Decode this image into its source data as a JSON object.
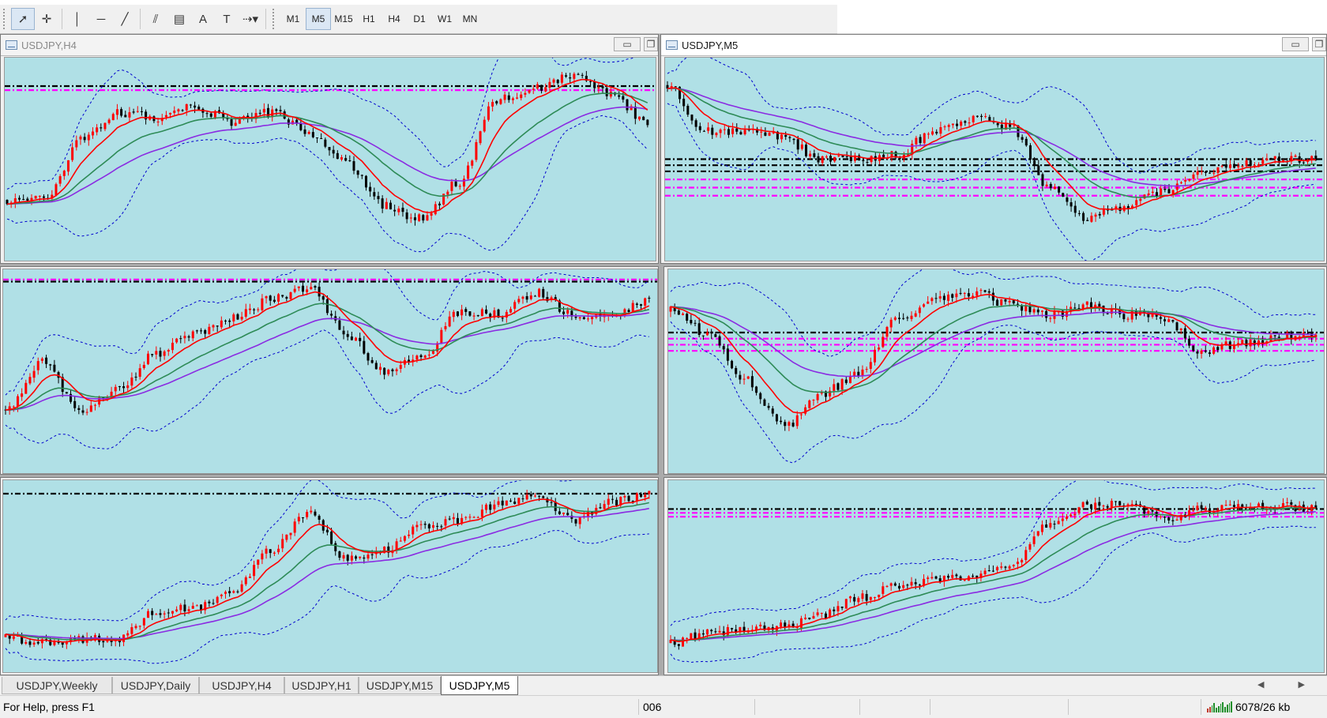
{
  "toolbar": {
    "tools": [
      {
        "icon": "cursor-arrow-icon",
        "glyph": "➚"
      },
      {
        "icon": "crosshair-icon",
        "glyph": "✛"
      },
      {
        "icon": "vertical-line-icon",
        "glyph": "│"
      },
      {
        "icon": "horizontal-line-icon",
        "glyph": "─"
      },
      {
        "icon": "trendline-icon",
        "glyph": "╱"
      },
      {
        "icon": "equidistant-channel-icon",
        "glyph": "⫽"
      },
      {
        "icon": "fibonacci-retracement-icon",
        "glyph": "▤"
      },
      {
        "icon": "text-tool-icon",
        "glyph": "A"
      },
      {
        "icon": "text-label-icon",
        "glyph": "T"
      },
      {
        "icon": "arrows-dropdown-icon",
        "glyph": "⇢▾"
      }
    ],
    "timeframes": [
      "M1",
      "M5",
      "M15",
      "H1",
      "H4",
      "D1",
      "W1",
      "MN"
    ],
    "active_timeframe": "M5"
  },
  "windows": [
    {
      "id": "w1",
      "title": "USDJPY,H4",
      "show_title": true,
      "active": false,
      "seed": 11,
      "levels": [
        {
          "y": 0.14,
          "color": "#000000"
        },
        {
          "y": 0.16,
          "color": "#ff00ff"
        }
      ],
      "shape": [
        0.72,
        0.7,
        0.4,
        0.25,
        0.28,
        0.22,
        0.3,
        0.25,
        0.36,
        0.52,
        0.75,
        0.82,
        0.62,
        0.18,
        0.12,
        0.05,
        0.15,
        0.3
      ]
    },
    {
      "id": "w2",
      "title": "USDJPY,M5",
      "show_title": true,
      "active": true,
      "seed": 23,
      "levels": [
        {
          "y": 0.5,
          "color": "#000000"
        },
        {
          "y": 0.53,
          "color": "#000000"
        },
        {
          "y": 0.56,
          "color": "#000000"
        },
        {
          "y": 0.6,
          "color": "#ff00ff"
        },
        {
          "y": 0.64,
          "color": "#ff00ff"
        },
        {
          "y": 0.68,
          "color": "#ff00ff"
        }
      ],
      "shape": [
        0.1,
        0.35,
        0.35,
        0.38,
        0.5,
        0.5,
        0.48,
        0.35,
        0.28,
        0.33,
        0.65,
        0.82,
        0.75,
        0.68,
        0.58,
        0.52,
        0.5,
        0.5
      ]
    },
    {
      "id": "w3",
      "title": "",
      "show_title": false,
      "active": false,
      "seed": 37,
      "levels": [
        {
          "y": 0.05,
          "color": "#ff00ff"
        },
        {
          "y": 0.06,
          "color": "#000000"
        }
      ],
      "shape": [
        0.7,
        0.45,
        0.72,
        0.6,
        0.4,
        0.3,
        0.22,
        0.12,
        0.05,
        0.3,
        0.5,
        0.42,
        0.18,
        0.2,
        0.08,
        0.2,
        0.22,
        0.12
      ]
    },
    {
      "id": "w4",
      "title": "",
      "show_title": false,
      "active": false,
      "seed": 53,
      "levels": [
        {
          "y": 0.31,
          "color": "#000000"
        },
        {
          "y": 0.34,
          "color": "#ff00ff"
        },
        {
          "y": 0.37,
          "color": "#ff00ff"
        },
        {
          "y": 0.4,
          "color": "#ff00ff"
        }
      ],
      "shape": [
        0.18,
        0.3,
        0.55,
        0.8,
        0.62,
        0.5,
        0.22,
        0.12,
        0.08,
        0.15,
        0.2,
        0.15,
        0.2,
        0.22,
        0.4,
        0.35,
        0.32,
        0.3
      ]
    },
    {
      "id": "w5",
      "title": "",
      "show_title": false,
      "active": false,
      "seed": 71,
      "levels": [
        {
          "y": 0.07,
          "color": "#000000"
        }
      ],
      "shape": [
        0.85,
        0.87,
        0.86,
        0.85,
        0.7,
        0.68,
        0.6,
        0.35,
        0.15,
        0.4,
        0.35,
        0.22,
        0.18,
        0.1,
        0.05,
        0.18,
        0.08,
        0.04
      ]
    },
    {
      "id": "w6",
      "title": "",
      "show_title": false,
      "active": false,
      "seed": 89,
      "levels": [
        {
          "y": 0.15,
          "color": "#000000"
        },
        {
          "y": 0.17,
          "color": "#ff00ff"
        },
        {
          "y": 0.19,
          "color": "#ff00ff"
        }
      ],
      "shape": [
        0.88,
        0.82,
        0.8,
        0.78,
        0.72,
        0.62,
        0.55,
        0.52,
        0.5,
        0.45,
        0.2,
        0.1,
        0.08,
        0.18,
        0.12,
        0.1,
        0.1,
        0.12
      ]
    }
  ],
  "tabs": [
    "USDJPY,Weekly",
    "USDJPY,Daily",
    "USDJPY,H4",
    "USDJPY,H1",
    "USDJPY,M15",
    "USDJPY,M5"
  ],
  "active_tab": "USDJPY,M5",
  "status": {
    "help": "For Help, press F1",
    "field2": "006",
    "connection": "6078/26 kb"
  },
  "colors": {
    "plot_bg": "#b0e0e6",
    "bull": "#ff0000",
    "bear": "#000000",
    "ma_fast": "#ff0000",
    "ma_mid": "#2e8b57",
    "ma_slow": "#8a2be2",
    "bands": "#0000cd"
  }
}
